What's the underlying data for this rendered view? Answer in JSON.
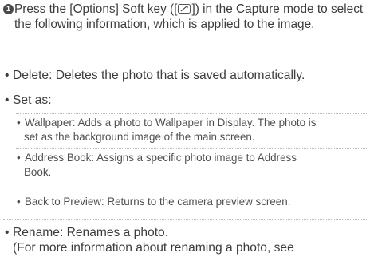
{
  "step": {
    "number": "1",
    "text_before_icon": "Press the [Options] Soft key ([",
    "text_after_icon": "]) in the Capture mode to select the following information, which is applied to the image."
  },
  "items": {
    "delete": "Delete: Deletes the photo that is saved automatically.",
    "set_as": "Set as:",
    "wallpaper_line1": "Wallpaper: Adds a photo to Wallpaper in Display. The photo is",
    "wallpaper_line2": "set as the background image of the main screen.",
    "address_line1": "Address Book: Assigns a specific photo image to Address",
    "address_line2": "Book.",
    "back_to_preview": "Back to Preview: Returns to the camera preview screen.",
    "rename_line1": "Rename: Renames a photo.",
    "rename_line2": "(For more information about renaming a photo, see"
  },
  "bullet": "•",
  "icons": {
    "step_marker": "circled-number-icon",
    "softkey": "options-softkey-icon"
  }
}
